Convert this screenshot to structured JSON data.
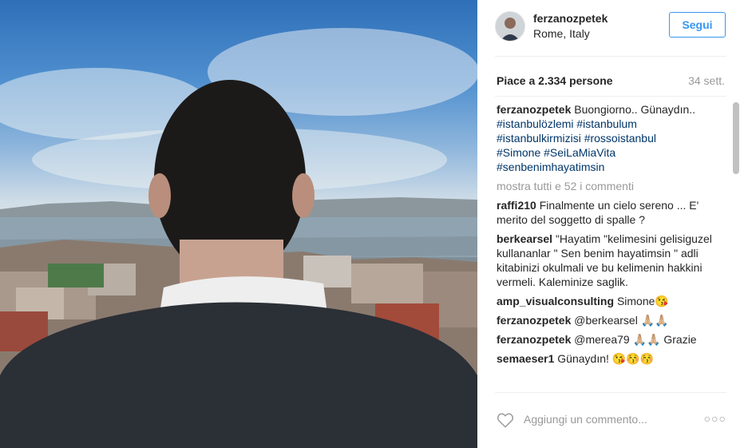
{
  "post": {
    "username": "ferzanozpetek",
    "location": "Rome, Italy",
    "follow_label": "Segui",
    "likes": "Piace a 2.334 persone",
    "age": "34 sett."
  },
  "caption": {
    "user": "ferzanozpetek",
    "text": "Buongiorno.. Günaydın..",
    "hashtags_line1": "#istanbulözlemi #istanbulum",
    "hashtags_line2": "#istanbulkirmizisi #rossoistanbul",
    "hashtags_line3": "#Simone #SeiLaMiaVita",
    "hashtags_line4": "#senbenimhayatimsin"
  },
  "show_all": "mostra tutti e 52 i commenti",
  "comments": [
    {
      "user": "raffi210",
      "text": "Finalmente un cielo sereno ... E' merito del soggetto di spalle ?"
    },
    {
      "user": "berkearsel",
      "text": "\"Hayatim \"kelimesini gelisiguzel kullananlar \" Sen benim hayatimsin \" adli kitabinizi okulmali ve bu kelimenin hakkini vermeli. Kaleminize saglik."
    },
    {
      "user": "amp_visualconsulting",
      "text": "Simone😘"
    },
    {
      "user": "ferzanozpetek",
      "text": "@berkearsel 🙏🏼🙏🏼"
    },
    {
      "user": "ferzanozpetek",
      "text": "@merea79 🙏🏼🙏🏼 Grazie"
    },
    {
      "user": "semaeser1",
      "text": "Günaydın! 😘😚😚"
    }
  ],
  "add_comment_placeholder": "Aggiungi un commento...",
  "more_options": "○○○",
  "icons": {
    "heart": "heart-outline-icon",
    "options": "more-options-icon"
  },
  "colors": {
    "accent": "#3897f0",
    "hashtag": "#003569",
    "muted": "#999999"
  }
}
